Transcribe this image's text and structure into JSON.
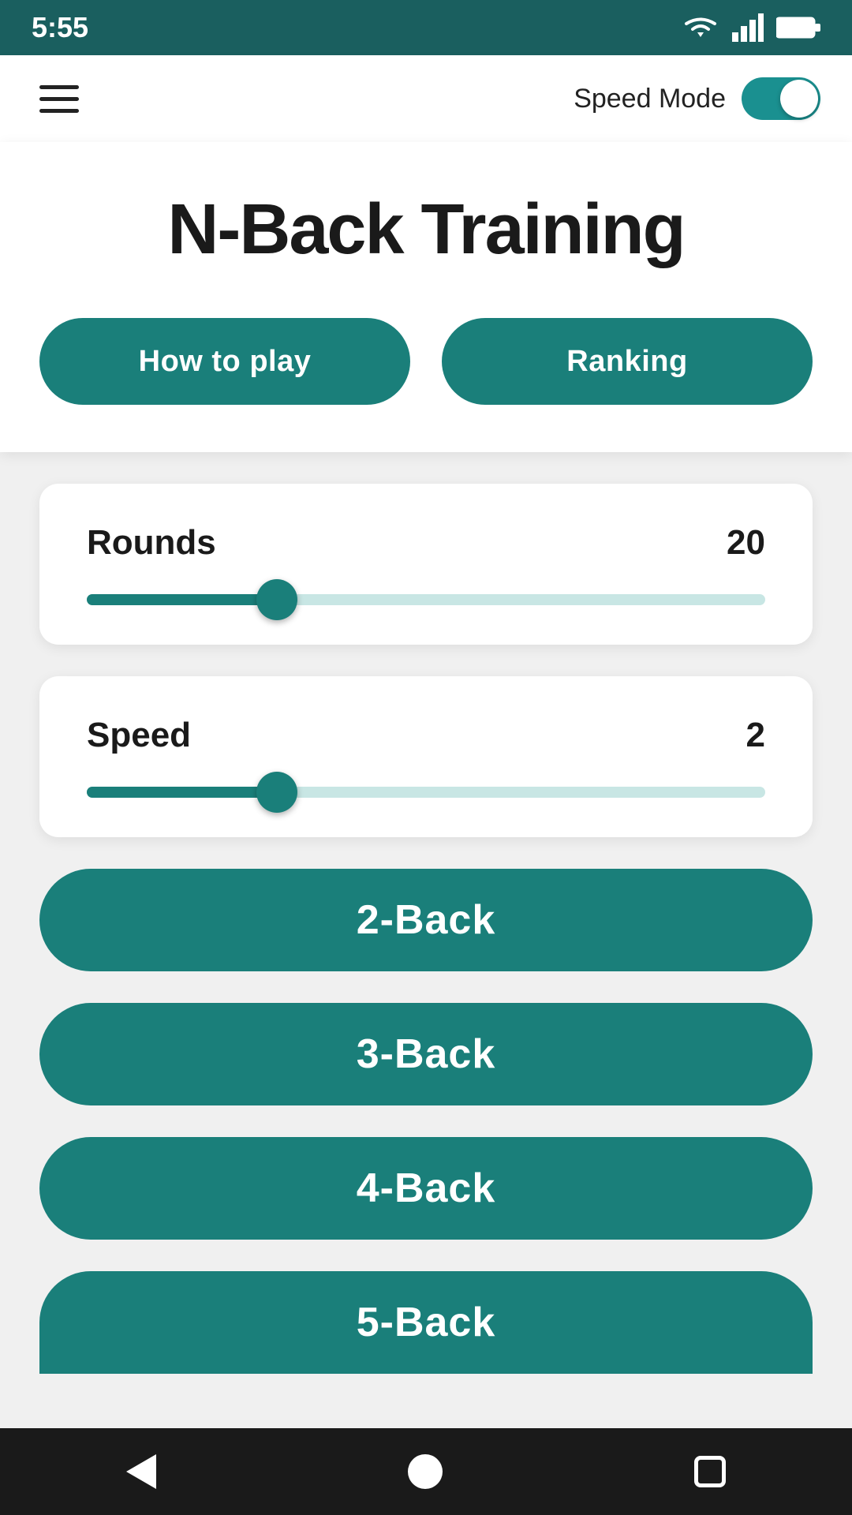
{
  "statusBar": {
    "time": "5:55"
  },
  "topNav": {
    "speedModeLabel": "Speed Mode",
    "toggleEnabled": true
  },
  "heroCard": {
    "title": "N-Back Training",
    "howToPlayLabel": "How to play",
    "rankingLabel": "Ranking"
  },
  "roundsSlider": {
    "label": "Rounds",
    "value": "20",
    "fillPercent": 28
  },
  "speedSlider": {
    "label": "Speed",
    "value": "2",
    "fillPercent": 28
  },
  "gameButtons": [
    {
      "label": "2-Back"
    },
    {
      "label": "3-Back"
    },
    {
      "label": "4-Back"
    },
    {
      "label": "5-Back"
    }
  ]
}
